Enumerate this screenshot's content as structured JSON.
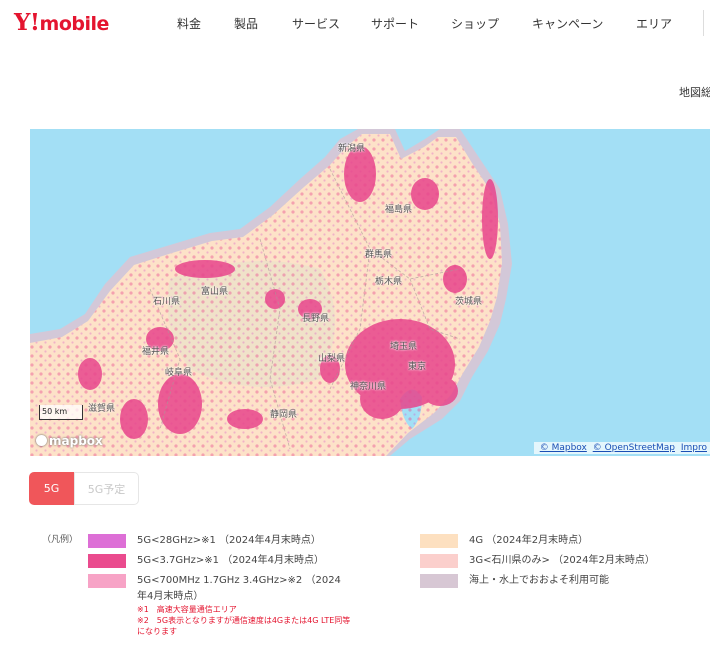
{
  "header": {
    "logo": {
      "mark": "Y!",
      "text": "mobile"
    },
    "nav": [
      "料金",
      "製品",
      "サービス",
      "サポート",
      "ショップ",
      "キャンペーン",
      "エリア"
    ]
  },
  "map": {
    "note": "地図総",
    "cities": [
      "新潟県",
      "福島県",
      "富山県",
      "石川県",
      "長野県",
      "福井県",
      "群馬県",
      "栃木県",
      "茨城県",
      "岐阜県",
      "山梨県",
      "埼玉県",
      "東京",
      "神奈川県",
      "静岡県",
      "滋賀県"
    ],
    "scale_label": "50 km",
    "logo_text": "mapbox",
    "attribution": [
      "© Mapbox",
      "© OpenStreetMap",
      "Impro"
    ],
    "colors": {
      "sea": "#a3dff5",
      "land": "#fde2c8",
      "coast": "#d3c8d8",
      "fiveG": "#e8458c"
    }
  },
  "tabs": {
    "active": "5G",
    "inactive": "5G予定"
  },
  "legend": {
    "heading": "（凡例）",
    "left": [
      {
        "label": "5G<28GHz>※1 （2024年4月末時点）",
        "color": "#dd6fd6"
      },
      {
        "label": "5G<3.7GHz>※1 （2024年4月末時点）",
        "color": "#ea4b8e"
      },
      {
        "label": "5G<700MHz 1.7GHz 3.4GHz>※2 （2024年4月末時点）",
        "color": "#f7a3c6"
      }
    ],
    "right": [
      {
        "label": "4G （2024年2月末時点）",
        "color": "#fde0c0"
      },
      {
        "label": "3G<石川県のみ> （2024年2月末時点）",
        "color": "#fbcfcc"
      },
      {
        "label": "海上・水上でおおよそ利用可能",
        "color": "#d7c7d4"
      }
    ],
    "notes": [
      "※1　高速大容量通信エリア",
      "※2　5G表示となりますが通信速度は4Gまたは4G LTE同等になります"
    ]
  }
}
